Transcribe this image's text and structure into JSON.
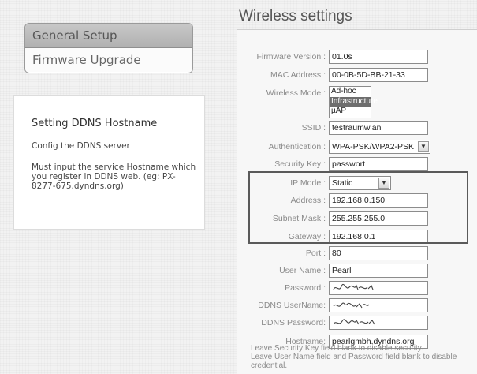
{
  "menu": {
    "items": [
      {
        "label": "General Setup"
      },
      {
        "label": "Firmware Upgrade"
      }
    ]
  },
  "help": {
    "title": "Setting DDNS Hostname",
    "subtitle": "Config the DDNS server",
    "body": "Must input the service Hostname which you register in DDNS web. (eg: PX-8277-675.dyndns.org)"
  },
  "page": {
    "title": "Wireless settings"
  },
  "form": {
    "firmware_version": {
      "label": "Firmware Version :",
      "value": "01.0s"
    },
    "mac_address": {
      "label": "MAC Address :",
      "value": "00-0B-5D-BB-21-33"
    },
    "wireless_mode": {
      "label": "Wireless Mode :",
      "options": [
        "Ad-hoc",
        "Infrastructure",
        "µAP"
      ],
      "selected": "Infrastructure"
    },
    "ssid": {
      "label": "SSID :",
      "value": "testraumwlan"
    },
    "authentication": {
      "label": "Authentication :",
      "value": "WPA-PSK/WPA2-PSK"
    },
    "security_key": {
      "label": "Security Key :",
      "value": "passwort"
    },
    "ip_mode": {
      "label": "IP Mode :",
      "value": "Static"
    },
    "address": {
      "label": "Address :",
      "value": "192.168.0.150"
    },
    "subnet_mask": {
      "label": "Subnet Mask :",
      "value": "255.255.255.0"
    },
    "gateway": {
      "label": "Gateway :",
      "value": "192.168.0.1"
    },
    "port": {
      "label": "Port :",
      "value": "80"
    },
    "user_name": {
      "label": "User Name :",
      "value": "Pearl"
    },
    "password": {
      "label": "Password :"
    },
    "ddns_username": {
      "label": "DDNS UserName:"
    },
    "ddns_password": {
      "label": "DDNS Password:"
    },
    "hostname": {
      "label": "Hostname:",
      "value": "pearlgmbh.dyndns.org"
    }
  },
  "notes": {
    "security": "Leave Security Key field blank to disable security.",
    "credential": "Leave User Name field and Password field blank to disable credential."
  },
  "colors": {
    "highlight_border": "#5a5a5a",
    "listbox_selected": "#6e6e6e"
  }
}
